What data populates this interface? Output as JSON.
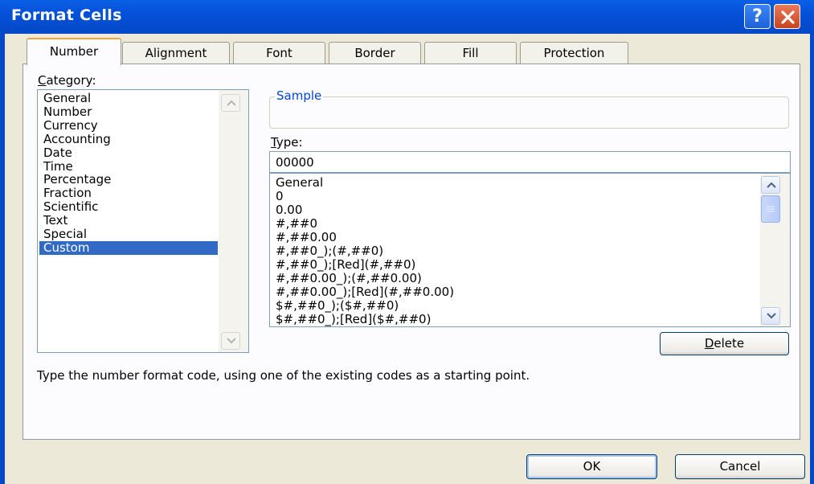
{
  "window": {
    "title": "Format Cells",
    "help_label": "?"
  },
  "tabs": [
    {
      "label": "Number",
      "active": true
    },
    {
      "label": "Alignment",
      "active": false
    },
    {
      "label": "Font",
      "active": false
    },
    {
      "label": "Border",
      "active": false
    },
    {
      "label": "Fill",
      "active": false
    },
    {
      "label": "Protection",
      "active": false
    }
  ],
  "category": {
    "label": "Category:",
    "items": [
      "General",
      "Number",
      "Currency",
      "Accounting",
      "Date",
      "Time",
      "Percentage",
      "Fraction",
      "Scientific",
      "Text",
      "Special",
      "Custom"
    ],
    "selected": "Custom"
  },
  "sample": {
    "label": "Sample"
  },
  "type": {
    "label": "Type:",
    "value": "00000",
    "formats": [
      "General",
      "0",
      "0.00",
      "#,##0",
      "#,##0.00",
      "#,##0_);(#,##0)",
      "#,##0_);[Red](#,##0)",
      "#,##0.00_);(#,##0.00)",
      "#,##0.00_);[Red](#,##0.00)",
      "$#,##0_);($#,##0)",
      "$#,##0_);[Red]($#,##0)"
    ]
  },
  "buttons": {
    "delete": "Delete",
    "ok": "OK",
    "cancel": "Cancel"
  },
  "description": "Type the number format code, using one of the existing codes as a starting point.",
  "colors": {
    "title_bar": "#0349C8",
    "selection": "#316AC5",
    "dialog_bg": "#ECE9D8",
    "active_tab_accent": "#F0A53A"
  }
}
